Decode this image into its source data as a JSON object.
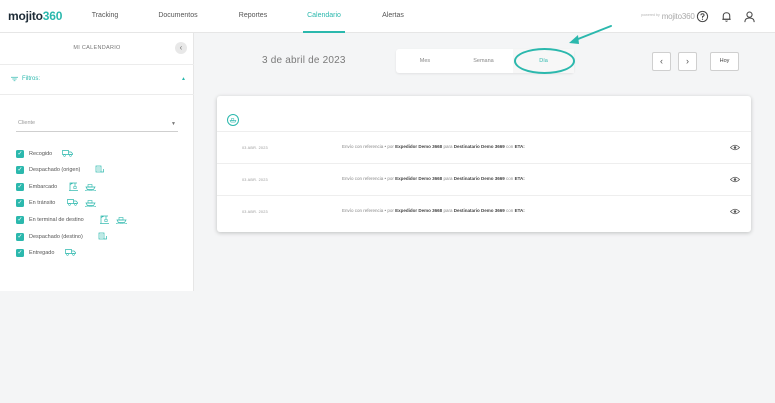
{
  "app": {
    "logo_main": "mojito",
    "logo_accent": "360",
    "brand_small_sub": "powered by",
    "brand_small": "mojito360"
  },
  "nav": {
    "items": [
      {
        "label": "Tracking"
      },
      {
        "label": "Documentos"
      },
      {
        "label": "Reportes"
      },
      {
        "label": "Calendario"
      },
      {
        "label": "Alertas"
      }
    ],
    "active": "Calendario",
    "right_icons": [
      "help-icon",
      "bell-icon",
      "user-icon"
    ]
  },
  "sidebar": {
    "title": "MI CALENDARIO",
    "filters_label": "Filtros:",
    "client_placeholder": "Cliente",
    "statuses": [
      {
        "label": "Recogido",
        "checked": true,
        "icons": [
          "truck-icon"
        ]
      },
      {
        "label": "Despachado (origen)",
        "checked": true,
        "icons": [
          "customs-icon"
        ]
      },
      {
        "label": "Embarcado",
        "checked": true,
        "icons": [
          "crane-icon",
          "ship-icon"
        ]
      },
      {
        "label": "En tránsito",
        "checked": true,
        "icons": [
          "truck-icon",
          "ship-icon"
        ]
      },
      {
        "label": "En terminal de destino",
        "checked": true,
        "icons": [
          "crane-icon",
          "ship-icon"
        ]
      },
      {
        "label": "Despachado (destino)",
        "checked": true,
        "icons": [
          "customs-icon"
        ]
      },
      {
        "label": "Entregado",
        "checked": true,
        "icons": [
          "truck-icon"
        ]
      }
    ]
  },
  "calendar": {
    "date_title": "3 de abril de 2023",
    "view_tabs": [
      {
        "label": "Mes"
      },
      {
        "label": "Semana"
      },
      {
        "label": "Día"
      }
    ],
    "selected_view": "Día",
    "prev_label": "‹",
    "next_label": "›",
    "today_label": "Hoy"
  },
  "events": [
    {
      "date": "03 ABR. 2023",
      "prefix": "Envío con referencia",
      "sep1": "• por",
      "shipper": "Expedidor Demo 3668",
      "sep2": "para",
      "consignee": "Destinatario Demo 3669",
      "sep3": "con",
      "eta": "ETA:"
    },
    {
      "date": "03 ABR. 2023",
      "prefix": "Envío con referencia",
      "sep1": "• por",
      "shipper": "Expedidor Demo 3668",
      "sep2": "para",
      "consignee": "Destinatario Demo 3669",
      "sep3": "con",
      "eta": "ETA:"
    },
    {
      "date": "03 ABR. 2023",
      "prefix": "Envío con referencia",
      "sep1": "• por",
      "shipper": "Expedidor Demo 3668",
      "sep2": "para",
      "consignee": "Destinatario Demo 3669",
      "sep3": "con",
      "eta": "ETA:"
    }
  ],
  "colors": {
    "accent": "#2bb8ad",
    "text": "#555555",
    "background": "#f4f5f6"
  }
}
